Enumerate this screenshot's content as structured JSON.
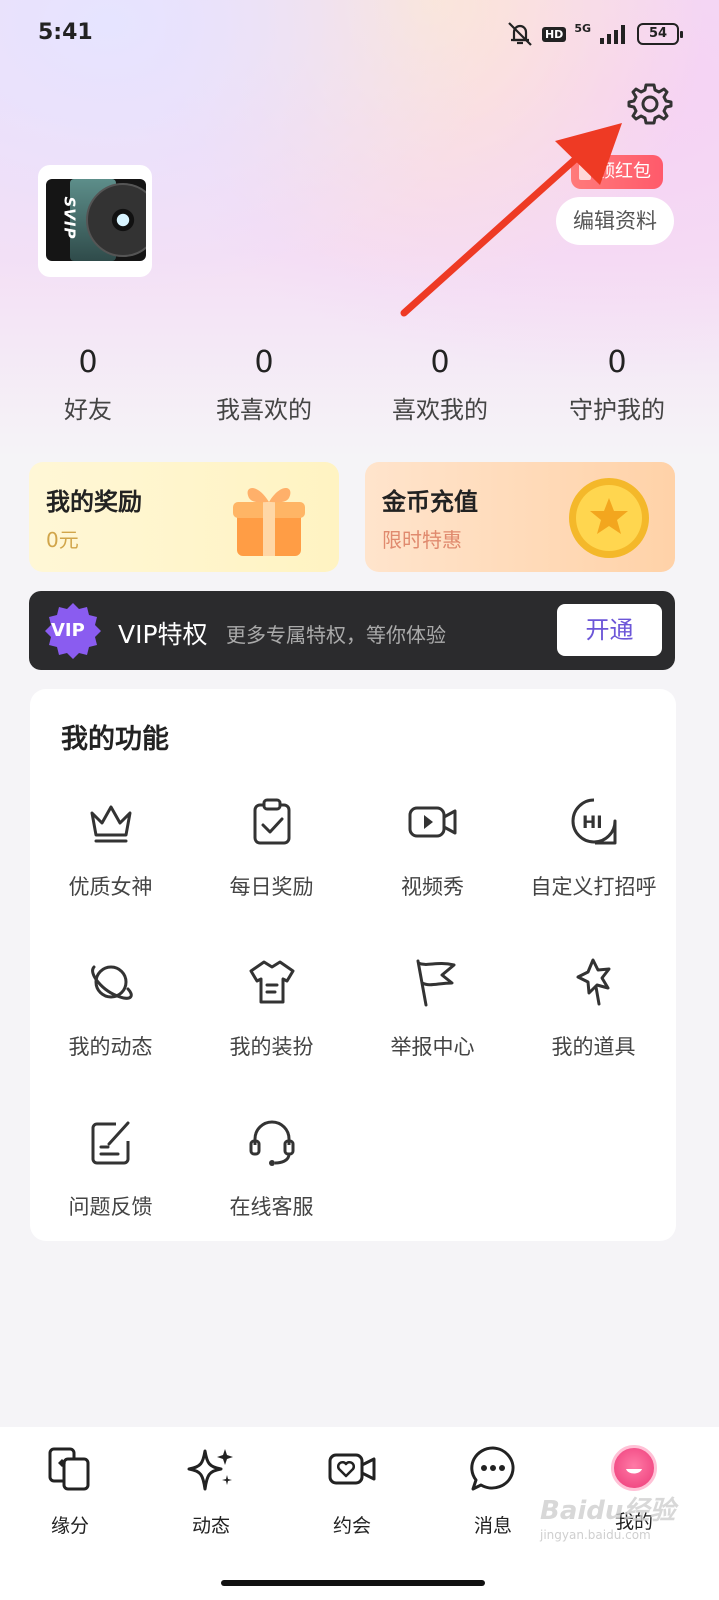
{
  "status_bar": {
    "time": "5:41",
    "hd": "HD",
    "network": "5G",
    "battery": "54"
  },
  "profile": {
    "avatar_badge": "SVIP",
    "red_packet_label": "领红包",
    "edit_label": "编辑资料"
  },
  "stats": [
    {
      "count": "0",
      "label": "好友"
    },
    {
      "count": "0",
      "label": "我喜欢的"
    },
    {
      "count": "0",
      "label": "喜欢我的"
    },
    {
      "count": "0",
      "label": "守护我的"
    }
  ],
  "cards": {
    "reward": {
      "title": "我的奖励",
      "sub": "0元"
    },
    "coin": {
      "title": "金币充值",
      "sub": "限时特惠"
    }
  },
  "vip": {
    "badge": "VIP",
    "title": "VIP特权",
    "desc": "更多专属特权，等你体验",
    "button": "开通"
  },
  "functions": {
    "title": "我的功能",
    "items": [
      {
        "label": "优质女神",
        "icon": "crown-icon"
      },
      {
        "label": "每日奖励",
        "icon": "clipboard-check-icon"
      },
      {
        "label": "视频秀",
        "icon": "video-camera-icon"
      },
      {
        "label": "自定义打招呼",
        "icon": "hi-bubble-icon"
      },
      {
        "label": "我的动态",
        "icon": "planet-icon"
      },
      {
        "label": "我的装扮",
        "icon": "shirt-icon"
      },
      {
        "label": "举报中心",
        "icon": "flag-icon"
      },
      {
        "label": "我的道具",
        "icon": "magic-wand-icon"
      },
      {
        "label": "问题反馈",
        "icon": "edit-note-icon"
      },
      {
        "label": "在线客服",
        "icon": "headset-icon"
      }
    ]
  },
  "tabs": [
    {
      "label": "缘分",
      "icon": "cards-icon"
    },
    {
      "label": "动态",
      "icon": "sparkle-icon"
    },
    {
      "label": "约会",
      "icon": "video-heart-icon"
    },
    {
      "label": "消息",
      "icon": "chat-icon"
    },
    {
      "label": "我的",
      "icon": "avatar-icon",
      "active": true
    }
  ],
  "watermark": {
    "text": "Baidu经验",
    "sub": "jingyan.baidu.com"
  },
  "colors": {
    "accent_purple": "#6c56d8",
    "red_packet": "#ff5a6b",
    "annotation_arrow": "#ee3a24"
  }
}
